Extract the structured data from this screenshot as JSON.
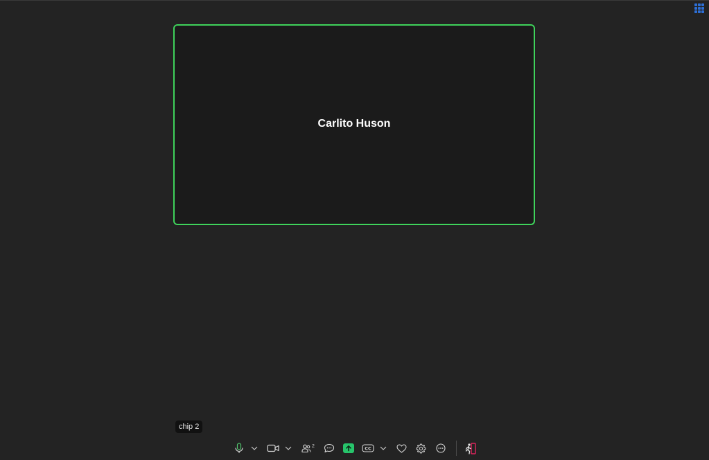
{
  "meeting": {
    "participant_name": "Carlito Huson",
    "chip_label": "chip 2"
  },
  "toolbar": {
    "participants_count": "2"
  },
  "colors": {
    "background": "#232323",
    "tile_background": "#1b1b1b",
    "speaker_border": "#3fd35b",
    "share_green": "#27c46b",
    "grid_blue": "#2d6fd6",
    "leave_red": "#e0245e"
  },
  "icons": {
    "top_right": "grid-view-icon",
    "toolbar": [
      "microphone-icon",
      "chevron-down-icon",
      "camera-icon",
      "chevron-down-icon",
      "participants-icon",
      "chat-icon",
      "share-screen-icon",
      "closed-captions-icon",
      "chevron-down-icon",
      "reactions-heart-icon",
      "settings-gear-icon",
      "more-options-icon",
      "leave-icon"
    ]
  }
}
